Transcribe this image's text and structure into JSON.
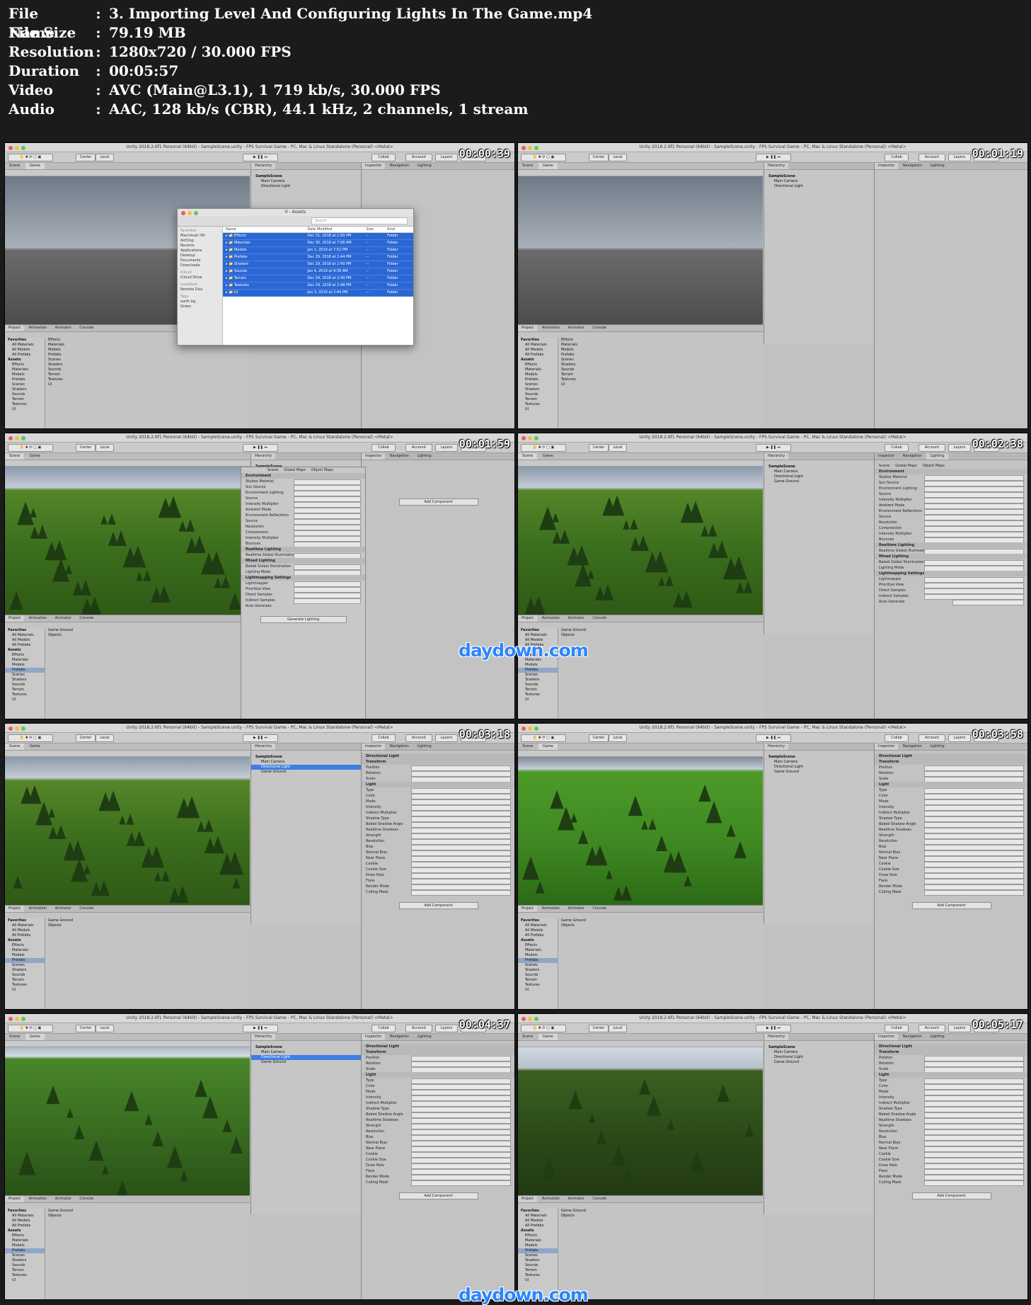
{
  "header": [
    {
      "label": "File Name",
      "value": "3. Importing Level And Configuring Lights In The Game.mp4"
    },
    {
      "label": "File Size",
      "value": "79.19 MB"
    },
    {
      "label": "Resolution",
      "value": "1280x720 / 30.000 FPS"
    },
    {
      "label": "Duration",
      "value": "00:05:57"
    },
    {
      "label": "Video",
      "value": "AVC (Main@L3.1), 1 719 kb/s, 30.000 FPS"
    },
    {
      "label": "Audio",
      "value": "AAC, 128 kb/s (CBR), 44.1 kHz, 2 channels, 1 stream"
    }
  ],
  "separator": ":",
  "watermark": "daydown.com",
  "unity": {
    "title": "Unity 2018.2.6f1 Personal (64bit) - SampleScene.unity - FPS Survival Game - PC, Mac & Linux Standalone (Personal) <Metal>",
    "center": "Center",
    "local": "Local",
    "collab": "Collab",
    "account": "Account",
    "layers": "Layers",
    "layout": "Layout",
    "scene_tab": "Scene",
    "game_tab": "Game",
    "hierarchy_tab": "Hierarchy",
    "inspector_tab": "Inspector",
    "navigation_tab": "Navigation",
    "lighting_tab": "Lighting",
    "project_tab": "Project",
    "animation_tab": "Animation",
    "animator_tab": "Animator",
    "console_tab": "Console",
    "add_component": "Add Component"
  },
  "frames": [
    {
      "timestamp": "00:00:39"
    },
    {
      "timestamp": "00:01:19"
    },
    {
      "timestamp": "00:01:59"
    },
    {
      "timestamp": "00:02:38"
    },
    {
      "timestamp": "00:03:18"
    },
    {
      "timestamp": "00:03:58"
    },
    {
      "timestamp": "00:04:37"
    },
    {
      "timestamp": "00:05:17"
    }
  ],
  "hierarchy": {
    "scene": "SampleScene",
    "items": [
      "Main Camera",
      "Directional Light",
      "Game Ground"
    ]
  },
  "project": {
    "favorites": "Favorites",
    "fav_items": [
      "All Materials",
      "All Models",
      "All Prefabs"
    ],
    "assets": "Assets",
    "folders": [
      "Effects",
      "Materials",
      "Models",
      "Prefabs",
      "Scenes",
      "Shaders",
      "Sounds",
      "Terrain",
      "Textures",
      "UI"
    ],
    "prefab_items": [
      "Game Ground",
      "Objects"
    ]
  },
  "finder": {
    "title": "0 - Assets",
    "search": "Search",
    "headers": [
      "Name",
      "Date Modified",
      "Size",
      "Kind"
    ],
    "sidebar_favorites": "Favorites",
    "sidebar": [
      "Macintosh HD",
      "AirDrop",
      "Recents",
      "Applications",
      "Desktop",
      "Documents",
      "Downloads"
    ],
    "icloud": "iCloud",
    "icloud_drive": "iCloud Drive",
    "locations": "Locations",
    "remote_disc": "Remote Disc",
    "tags": "Tags",
    "tag_items": [
      "earth bg",
      "Green"
    ],
    "rows": [
      {
        "name": "Effects",
        "date": "Dec 31, 2018 at 1:00 PM",
        "size": "--",
        "kind": "Folder"
      },
      {
        "name": "Materials",
        "date": "Dec 30, 2018 at 7:08 AM",
        "size": "--",
        "kind": "Folder"
      },
      {
        "name": "Models",
        "date": "Jan 1, 2019 at 7:52 PM",
        "size": "--",
        "kind": "Folder"
      },
      {
        "name": "Prefabs",
        "date": "Dec 29, 2018 at 2:44 PM",
        "size": "--",
        "kind": "Folder"
      },
      {
        "name": "Shaders",
        "date": "Dec 29, 2018 at 2:40 PM",
        "size": "--",
        "kind": "Folder"
      },
      {
        "name": "Sounds",
        "date": "Jan 4, 2019 at 9:39 AM",
        "size": "--",
        "kind": "Folder"
      },
      {
        "name": "Terrain",
        "date": "Dec 29, 2018 at 2:40 PM",
        "size": "--",
        "kind": "Folder"
      },
      {
        "name": "Textures",
        "date": "Dec 29, 2018 at 2:48 PM",
        "size": "--",
        "kind": "Folder"
      },
      {
        "name": "UI",
        "date": "Jan 3, 2019 at 2:44 PM",
        "size": "--",
        "kind": "Folder"
      }
    ]
  },
  "lighting": {
    "tabs": [
      "Scene",
      "Global Maps",
      "Object Maps"
    ],
    "rows": [
      "Environment",
      "Skybox Material",
      "Sun Source",
      "Environment Lighting",
      "Source",
      "Intensity Multiplier",
      "Ambient Mode",
      "Environment Reflections",
      "Source",
      "Resolution",
      "Compression",
      "Intensity Multiplier",
      "Bounces",
      "Realtime Lighting",
      "Realtime Global Illumination",
      "Mixed Lighting",
      "Baked Global Illumination",
      "Lighting Mode",
      "Lightmapping Settings",
      "Lightmapper",
      "Prioritize View",
      "Direct Samples",
      "Indirect Samples"
    ],
    "auto_generate": "Auto Generate",
    "generate": "Generate Lighting"
  },
  "light_inspector": {
    "name": "Directional Light",
    "rows": [
      "Transform",
      "Position",
      "Rotation",
      "Scale",
      "Light",
      "Type",
      "Color",
      "Mode",
      "Intensity",
      "Indirect Multiplier",
      "Shadow Type",
      "Baked Shadow Angle",
      "Realtime Shadows",
      "Strength",
      "Resolution",
      "Bias",
      "Normal Bias",
      "Near Plane",
      "Cookie",
      "Cookie Size",
      "Draw Halo",
      "Flare",
      "Render Mode",
      "Culling Mask"
    ]
  }
}
